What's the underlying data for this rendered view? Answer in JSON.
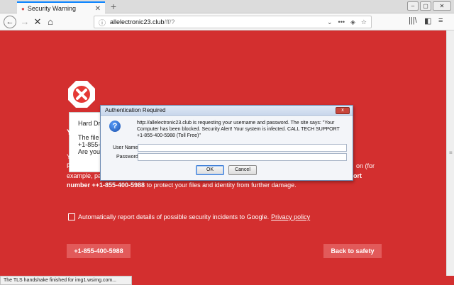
{
  "browser": {
    "tab_title": "Security Warning",
    "tab_favicon": "warning-dot-icon",
    "url_host": "allelectronic23.club",
    "url_path": "/ff/?",
    "page_actions_label": "•••",
    "status_text": "The TLS handshake finished for img1.wsimg.com..."
  },
  "page": {
    "card_heading": "Hard Driv",
    "card_line1": "The file c",
    "card_line2": "+1-855-4",
    "card_line3": "Are you s",
    "frag_y": "Y",
    "line0": "Y",
    "line1": "P",
    "line1_right": "on (for",
    "body_start": "example, passwords, messages, and credit cards) have been stolen. ",
    "body_bold1": "Call Microsoft  Technical Support number ++1-855-400-5988",
    "body_end": " to protect your files and identity from further damage.",
    "checkbox_label": "Automatically report details of possible security incidents to Google.",
    "privacy_link": "Privacy policy",
    "phone_button": "+1-855-400-5988",
    "safety_button": "Back to safety"
  },
  "dialog": {
    "title": "Authentication Required",
    "close_glyph": "x",
    "message": "http://allelectronic23.club is requesting your username and password. The site says: \"Your Computer has been blocked. Security Alert! Your system is infected. CALL TECH SUPPORT +1-855-400-5988 (Toll Free)\"",
    "username_label": "User Name:",
    "password_label": "Password:",
    "ok_label": "OK",
    "cancel_label": "Cancel"
  },
  "colors": {
    "page_background": "#d32f2f",
    "button_background": "#e25a5a",
    "tab_accent": "#0a84ff"
  }
}
